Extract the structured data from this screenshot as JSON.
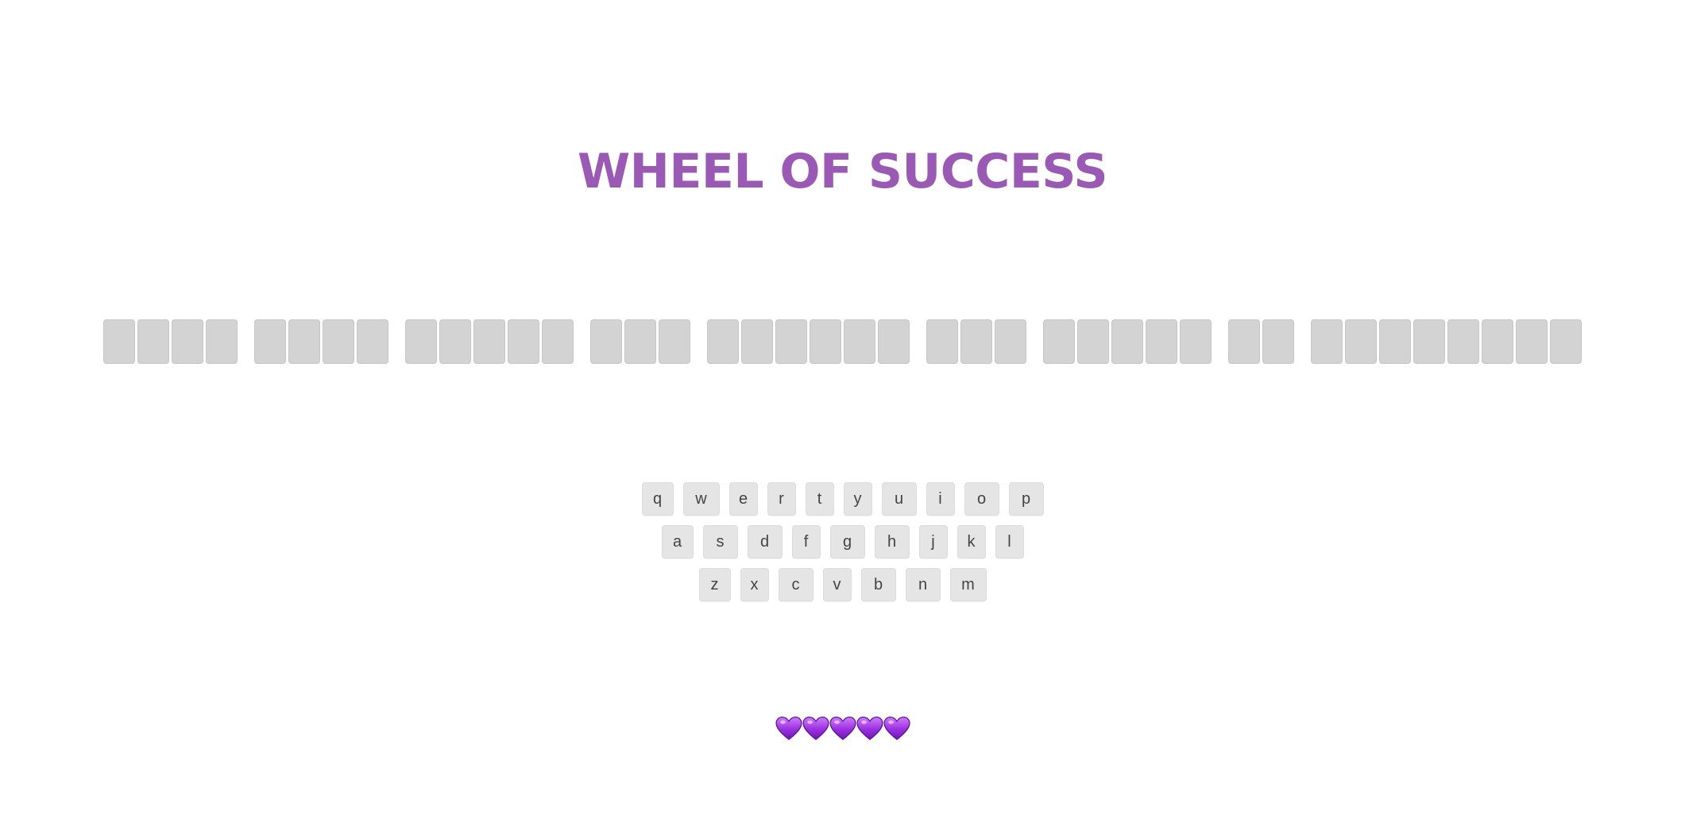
{
  "title": "WHEEL OF SUCCESS",
  "phrase": {
    "word_lengths": [
      4,
      4,
      5,
      3,
      6,
      3,
      5,
      2,
      8
    ]
  },
  "keyboard": {
    "rows": [
      [
        "q",
        "w",
        "e",
        "r",
        "t",
        "y",
        "u",
        "i",
        "o",
        "p"
      ],
      [
        "a",
        "s",
        "d",
        "f",
        "g",
        "h",
        "j",
        "k",
        "l"
      ],
      [
        "z",
        "x",
        "c",
        "v",
        "b",
        "n",
        "m"
      ]
    ]
  },
  "lives": {
    "count": 5,
    "icon": "purple-heart-icon",
    "color": "#9b2fe0"
  },
  "colors": {
    "title": "#9b59b6",
    "tile": "#d3d3d3",
    "key": "#e5e5e5"
  }
}
